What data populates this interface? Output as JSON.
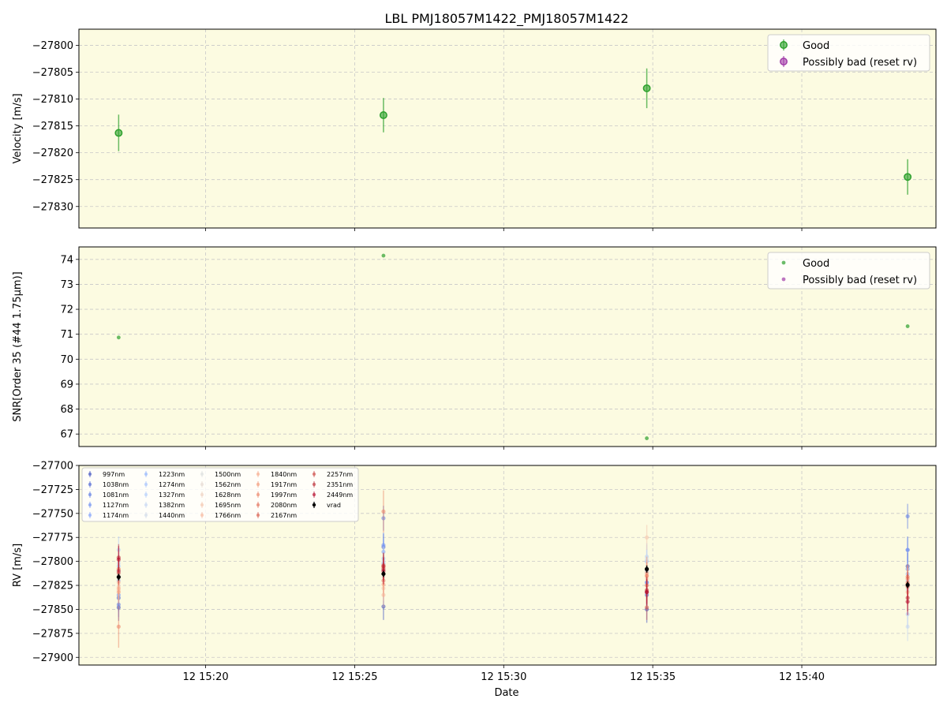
{
  "figure": {
    "title": "LBL PMJ18057M1422_PMJ18057M1422",
    "xlabel": "Date",
    "background": "#ffffff",
    "axes_facecolor": "#fcfbe1"
  },
  "colors": {
    "good": "#2ca02c",
    "bad": "#a13ca8",
    "vrad": "#000000",
    "grid": "#c8c8c8"
  },
  "x_ticks": [
    "12 15:20",
    "12 15:25",
    "12 15:30",
    "12 15:35",
    "12 15:40"
  ],
  "chart_data": [
    {
      "type": "scatter",
      "panel": "velocity",
      "ylabel": "Velocity [m/s]",
      "ylim": [
        -27834,
        -27797
      ],
      "xlim": [
        "15:15:45",
        "15:44:30"
      ],
      "yticks": [
        -27800,
        -27805,
        -27810,
        -27815,
        -27820,
        -27825,
        -27830
      ],
      "ytick_labels": [
        "−27800",
        "−27805",
        "−27810",
        "−27815",
        "−27820",
        "−27825",
        "−27830"
      ],
      "grid": true,
      "legend": {
        "placement": "upper right",
        "entries": [
          "Good",
          "Possibly bad (reset rv)"
        ]
      },
      "series": [
        {
          "name": "Good",
          "x": [
            "15:17:05",
            "15:25:58",
            "15:34:48",
            "15:43:33"
          ],
          "y": [
            -27816.3,
            -27813.0,
            -27808.0,
            -27824.5
          ],
          "yerr": [
            3.4,
            3.2,
            3.7,
            3.3
          ]
        },
        {
          "name": "Possibly bad (reset rv)",
          "x": [],
          "y": [],
          "yerr": []
        }
      ]
    },
    {
      "type": "scatter",
      "panel": "snr",
      "ylabel": "SNR[Order 35 (#44 1.75μm)]",
      "ylim": [
        66.5,
        74.5
      ],
      "xlim": [
        "15:15:45",
        "15:44:30"
      ],
      "yticks": [
        67,
        68,
        69,
        70,
        71,
        72,
        73,
        74
      ],
      "ytick_labels": [
        "67",
        "68",
        "69",
        "70",
        "71",
        "72",
        "73",
        "74"
      ],
      "grid": true,
      "legend": {
        "placement": "upper right",
        "entries": [
          "Good",
          "Possibly bad (reset rv)"
        ]
      },
      "series": [
        {
          "name": "Good",
          "x": [
            "15:17:05",
            "15:25:58",
            "15:34:48",
            "15:43:33"
          ],
          "y": [
            70.87,
            74.15,
            66.83,
            71.32
          ]
        },
        {
          "name": "Possibly bad (reset rv)",
          "x": [],
          "y": []
        }
      ]
    },
    {
      "type": "scatter",
      "panel": "rv",
      "ylabel": "RV [m/s]",
      "ylim": [
        -27908,
        -27700
      ],
      "xlim": [
        "15:15:45",
        "15:44:30"
      ],
      "yticks": [
        -27700,
        -27725,
        -27750,
        -27775,
        -27800,
        -27825,
        -27850,
        -27875,
        -27900
      ],
      "ytick_labels": [
        "−27700",
        "−27725",
        "−27750",
        "−27775",
        "−27800",
        "−27825",
        "−27850",
        "−27875",
        "−27900"
      ],
      "grid": true,
      "legend": {
        "placement": "upper left",
        "columns": 5
      },
      "x": [
        "15:17:05",
        "15:25:58",
        "15:34:48",
        "15:43:33"
      ],
      "series": [
        {
          "name": "997nm",
          "color": "#3b4cc0",
          "y": [
            -27848,
            -27847,
            -27850,
            -27805
          ],
          "yerr": [
            14,
            14,
            14,
            14
          ]
        },
        {
          "name": "1038nm",
          "color": "#4a63d3",
          "y": [
            -27838,
            -27785,
            -27835,
            -27788
          ],
          "yerr": [
            14,
            14,
            14,
            14
          ]
        },
        {
          "name": "1081nm",
          "color": "#5b7ae5",
          "y": [
            -27845,
            -27755,
            -27822,
            -27753
          ],
          "yerr": [
            13,
            13,
            13,
            13
          ]
        },
        {
          "name": "1127nm",
          "color": "#6c8ef2",
          "y": [
            -27835,
            -27783,
            -27832,
            -27808
          ],
          "yerr": [
            13,
            13,
            13,
            13
          ]
        },
        {
          "name": "1174nm",
          "color": "#7ea0fc",
          "y": [
            -27820,
            -27790,
            -27822,
            -27788
          ],
          "yerr": [
            13,
            13,
            13,
            13
          ]
        },
        {
          "name": "1223nm",
          "color": "#90b2fe",
          "y": [
            -27810,
            -27802,
            -27810,
            -27813
          ],
          "yerr": [
            13,
            13,
            13,
            13
          ]
        },
        {
          "name": "1274nm",
          "color": "#a3c2fe",
          "y": [
            -27805,
            -27797,
            -27800,
            -27820
          ],
          "yerr": [
            13,
            13,
            13,
            13
          ]
        },
        {
          "name": "1327nm",
          "color": "#b3cdfb",
          "y": [
            -27788,
            -27808,
            -27795,
            -27855
          ],
          "yerr": [
            14,
            14,
            14,
            14
          ]
        },
        {
          "name": "1382nm",
          "color": "#c4d5f3",
          "y": [
            -27802,
            -27800,
            -27812,
            -27868
          ],
          "yerr": [
            15,
            15,
            15,
            15
          ]
        },
        {
          "name": "1440nm",
          "color": "#d1dae9",
          "y": [
            -27812,
            -27820,
            -27798,
            -27830
          ],
          "yerr": [
            15,
            15,
            15,
            15
          ]
        },
        {
          "name": "1500nm",
          "color": "#dcdddd",
          "y": [
            -27815,
            -27810,
            -27808,
            -27825
          ],
          "yerr": [
            14,
            14,
            14,
            14
          ]
        },
        {
          "name": "1562nm",
          "color": "#e5d8d1",
          "y": [
            -27820,
            -27816,
            -27812,
            -27828
          ],
          "yerr": [
            13,
            13,
            13,
            13
          ]
        },
        {
          "name": "1628nm",
          "color": "#eed0c0",
          "y": [
            -27826,
            -27820,
            -27818,
            -27822
          ],
          "yerr": [
            13,
            13,
            13,
            13
          ]
        },
        {
          "name": "1695nm",
          "color": "#f4c4ad",
          "y": [
            -27830,
            -27828,
            -27775,
            -27818
          ],
          "yerr": [
            13,
            13,
            13,
            13
          ]
        },
        {
          "name": "1766nm",
          "color": "#f7b89c",
          "y": [
            -27822,
            -27835,
            -27815,
            -27825
          ],
          "yerr": [
            13,
            13,
            13,
            13
          ]
        },
        {
          "name": "1840nm",
          "color": "#f7a889",
          "y": [
            -27828,
            -27824,
            -27812,
            -27832
          ],
          "yerr": [
            13,
            13,
            13,
            13
          ]
        },
        {
          "name": "1917nm",
          "color": "#f39778",
          "y": [
            -27832,
            -27820,
            -27808,
            -27818
          ],
          "yerr": [
            13,
            13,
            13,
            13
          ]
        },
        {
          "name": "1997nm",
          "color": "#ec8467",
          "y": [
            -27868,
            -27748,
            -27815,
            -27822
          ],
          "yerr": [
            22,
            22,
            14,
            13
          ]
        },
        {
          "name": "2080nm",
          "color": "#e36f58",
          "y": [
            -27808,
            -27806,
            -27825,
            -27816
          ],
          "yerr": [
            13,
            13,
            13,
            13
          ]
        },
        {
          "name": "2167nm",
          "color": "#d85a4a",
          "y": [
            -27812,
            -27804,
            -27848,
            -27824
          ],
          "yerr": [
            13,
            13,
            13,
            13
          ]
        },
        {
          "name": "2257nm",
          "color": "#cb4340",
          "y": [
            -27810,
            -27808,
            -27832,
            -27826
          ],
          "yerr": [
            13,
            13,
            13,
            13
          ]
        },
        {
          "name": "2351nm",
          "color": "#bb2a36",
          "y": [
            -27796,
            -27805,
            -27830,
            -27838
          ],
          "yerr": [
            14,
            14,
            14,
            14
          ]
        },
        {
          "name": "2449nm",
          "color": "#b40426",
          "y": [
            -27798,
            -27810,
            -27832,
            -27842
          ],
          "yerr": [
            14,
            14,
            14,
            14
          ]
        },
        {
          "name": "vrad",
          "color": "#000000",
          "y": [
            -27816.3,
            -27813.0,
            -27808.0,
            -27824.5
          ],
          "yerr": [
            3.4,
            3.2,
            3.7,
            3.3
          ]
        }
      ]
    }
  ]
}
